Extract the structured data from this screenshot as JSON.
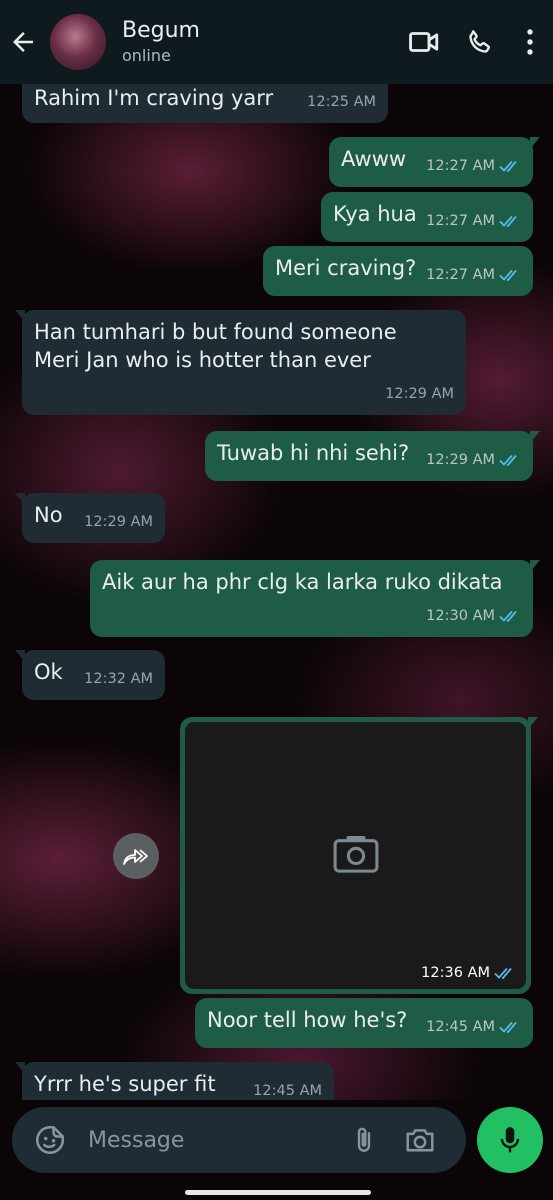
{
  "header": {
    "contact_name": "Begum",
    "status": "online",
    "icons": [
      "back-arrow-icon",
      "video-call-icon",
      "voice-call-icon",
      "more-options-icon"
    ]
  },
  "messages": [
    {
      "dir": "in",
      "text": "Rahim I'm craving yarr",
      "time": "12:25 AM"
    },
    {
      "dir": "out",
      "text": "Awww",
      "time": "12:27 AM",
      "read": true
    },
    {
      "dir": "out",
      "text": "Kya hua",
      "time": "12:27 AM",
      "read": true
    },
    {
      "dir": "out",
      "text": "Meri craving?",
      "time": "12:27 AM",
      "read": true
    },
    {
      "dir": "in",
      "text": "Han tumhari b but found someone Meri Jan who is hotter than ever",
      "time": "12:29 AM"
    },
    {
      "dir": "out",
      "text": "Tuwab hi nhi sehi?",
      "time": "12:29 AM",
      "read": true
    },
    {
      "dir": "in",
      "text": "No",
      "time": "12:29 AM"
    },
    {
      "dir": "out",
      "text": "Aik aur ha phr clg ka larka ruko dikata",
      "time": "12:30 AM",
      "read": true
    },
    {
      "dir": "in",
      "text": "Ok",
      "time": "12:32 AM"
    },
    {
      "dir": "out",
      "type": "photo",
      "time": "12:36 AM",
      "read": true
    },
    {
      "dir": "out",
      "text": "Noor tell how he's?",
      "time": "12:45 AM",
      "read": true
    },
    {
      "dir": "in",
      "text": "Yrrr he's super fit",
      "time": "12:45 AM"
    }
  ],
  "composer": {
    "placeholder": "Message"
  },
  "colors": {
    "header_bg": "#0f1a1e",
    "incoming_bubble": "#1f2c34",
    "outgoing_bubble": "#1f5c45",
    "read_tick": "#53bdeb",
    "mic_button": "#21c063"
  }
}
